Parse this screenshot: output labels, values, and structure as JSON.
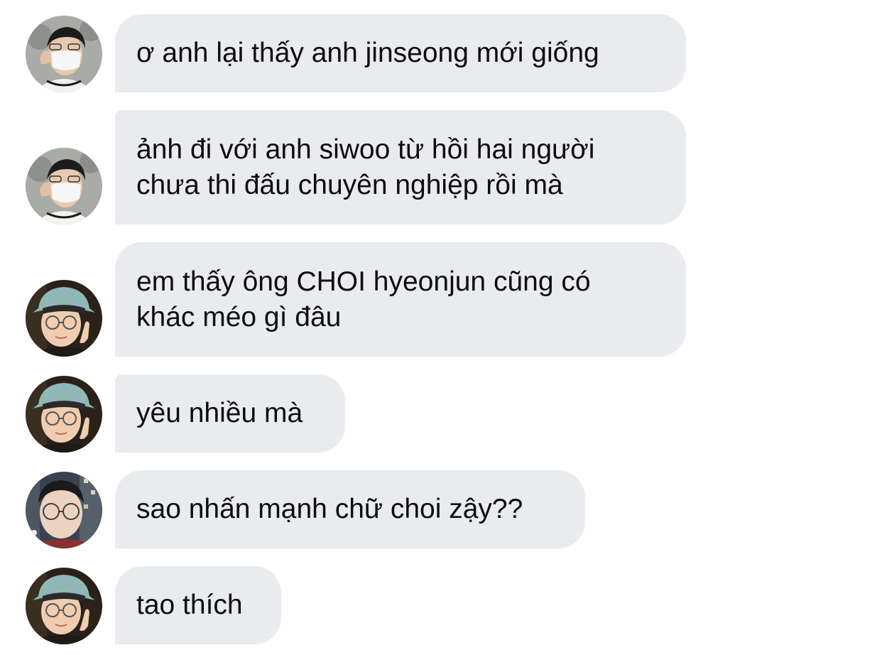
{
  "conversation": {
    "messages": [
      {
        "sender_avatar": "masked-person-avatar",
        "text": "ơ anh lại thấy anh jinseong mới giống"
      },
      {
        "sender_avatar": "masked-person-avatar",
        "text": "ảnh đi với anh siwoo từ hồi hai người\nchưa thi đấu chuyên nghiệp rồi mà"
      },
      {
        "sender_avatar": "bucket-hat-person-avatar",
        "text": "em thấy ông CHOI hyeonjun cũng có\nkhác méo gì đâu"
      },
      {
        "sender_avatar": "bucket-hat-person-avatar",
        "text": "yêu nhiều mà"
      },
      {
        "sender_avatar": "glasses-person-night-avatar",
        "text": "sao nhấn mạnh chữ choi zậy??"
      },
      {
        "sender_avatar": "bucket-hat-person-avatar",
        "text": "tao thích"
      }
    ]
  },
  "colors": {
    "bubble_background": "#e9ebef",
    "text": "#0d0d0d",
    "page_background": "#ffffff"
  }
}
